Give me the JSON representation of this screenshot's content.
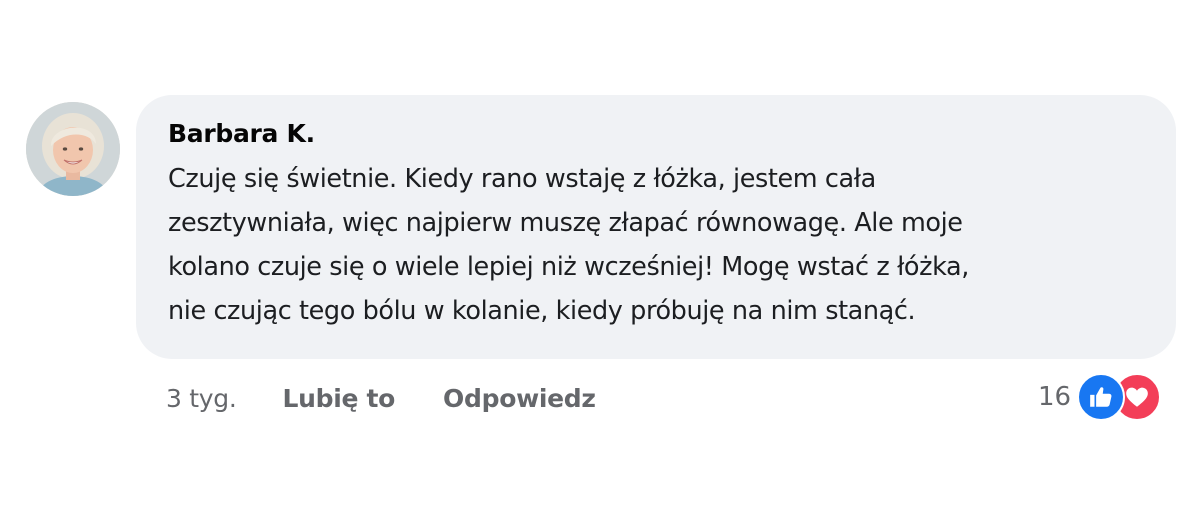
{
  "comment": {
    "author": "Barbara K.",
    "text": "Czuję się świetnie. Kiedy rano wstaję z łóżka, jestem cała\nzesztywniała, więc najpierw muszę złapać równowagę. Ale moje\nkolano czuje się o wiele lepiej niż wcześniej! Mogę wstać z łóżka,\nnie czując tego bólu w kolanie, kiedy próbuję na nim stanąć.",
    "avatar_icon": "avatar-photo"
  },
  "actions": {
    "time": "3 tyg.",
    "like_label": "Lubię to",
    "reply_label": "Odpowiedz"
  },
  "reactions": {
    "count": "16",
    "icons": [
      "like-icon",
      "love-icon"
    ],
    "colors": {
      "like": "#1877f2",
      "love": "#f33e58"
    }
  }
}
